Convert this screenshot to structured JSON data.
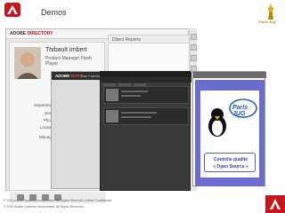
{
  "slide": {
    "title": "Demos"
  },
  "mascot": {
    "caption": "Paris Jug"
  },
  "directory": {
    "brand_prefix": "ADOBE",
    "brand_suffix": "DIRECTORY",
    "person_name": "Thibault Imbert",
    "person_title": "Product Manager Flash Player",
    "fields": [
      "Department:",
      "Email:",
      "Phone:",
      "Location:",
      "Manager:"
    ],
    "reports_title": "Direct Reports"
  },
  "maps": {
    "brand_prefix": "ADOBE",
    "brand_suffix": "MAPS",
    "location": "San Francisco, CA"
  },
  "presentation": {
    "logo_text": "Paris JUG",
    "line1": "Contrôle qualité",
    "line2": "« Open Source »"
  },
  "footer": {
    "line1": "© 2011 Adobe Systems Incorporated. All Rights Reserved. Adobe Confidential.",
    "line2": "© 2010 Adobe Systems Incorporated. All Rights Reserved."
  },
  "colors": {
    "accent": "#c4161c",
    "slide_blue": "#6c6cd0",
    "dark_app": "#3a3a3a"
  }
}
